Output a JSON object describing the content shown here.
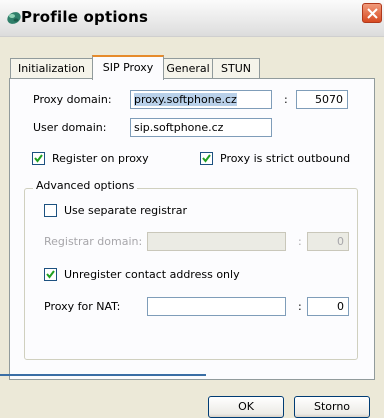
{
  "window": {
    "title": "Profile options",
    "app_icon": "globe-icon",
    "close_icon": "close-icon"
  },
  "tabs": [
    {
      "label": "Initialization",
      "active": false
    },
    {
      "label": "SIP Proxy",
      "active": true
    },
    {
      "label": "General",
      "active": false
    },
    {
      "label": "STUN",
      "active": false
    }
  ],
  "sip_proxy": {
    "proxy_domain_label": "Proxy domain:",
    "proxy_domain_value": "proxy.softphone.cz",
    "proxy_port_separator": ":",
    "proxy_port_value": "5070",
    "user_domain_label": "User domain:",
    "user_domain_value": "sip.softphone.cz",
    "register_on_proxy": {
      "label": "Register on proxy",
      "checked": true
    },
    "proxy_strict_outbound": {
      "label": "Proxy is strict outbound",
      "checked": true
    }
  },
  "advanced": {
    "title": "Advanced options",
    "use_separate_registrar": {
      "label": "Use separate registrar",
      "checked": false
    },
    "registrar_domain_label": "Registrar domain:",
    "registrar_domain_value": "",
    "registrar_port_separator": ":",
    "registrar_port_value": "0",
    "unregister_contact_only": {
      "label": "Unregister contact address only",
      "checked": true
    },
    "proxy_for_nat_label": "Proxy for NAT:",
    "proxy_for_nat_value": "",
    "nat_port_separator": ":",
    "nat_port_value": "0"
  },
  "buttons": {
    "ok_label": "OK",
    "cancel_label": "Storno"
  },
  "colors": {
    "tab_highlight": "#e68b2c",
    "field_border": "#7f9db9",
    "selection": "#b9d1ea",
    "close_red": "#d74a22"
  }
}
